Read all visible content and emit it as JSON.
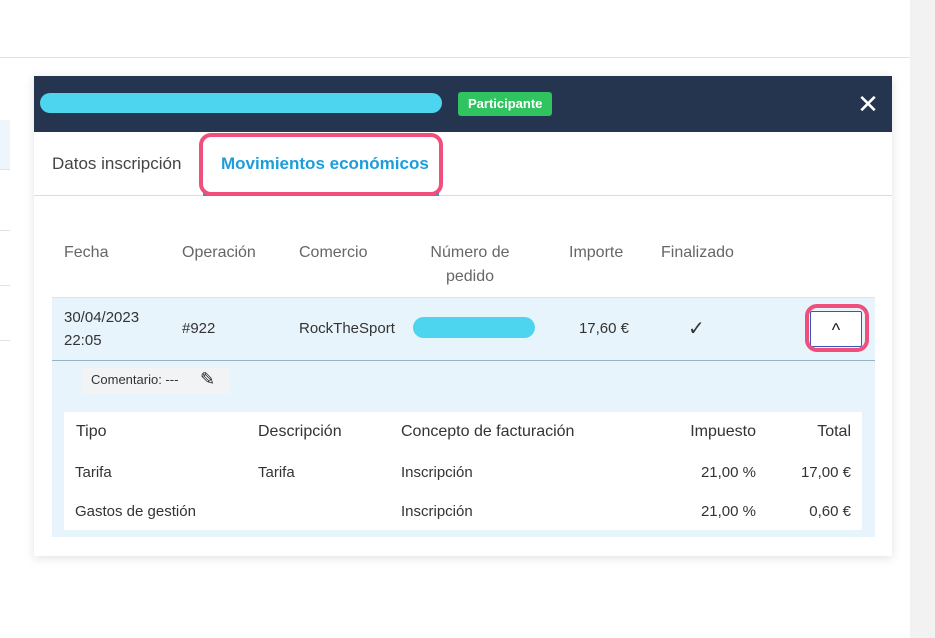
{
  "header": {
    "badge": "Participante",
    "close_glyph": "✕"
  },
  "tabs": [
    {
      "label": "Datos inscripción"
    },
    {
      "label": "Movimientos económicos"
    }
  ],
  "table": {
    "headers": [
      "Fecha",
      "Operación",
      "Comercio",
      "Número de pedido",
      "Importe",
      "Finalizado"
    ],
    "row": {
      "date": "30/04/2023",
      "time": "22:05",
      "operation": "#922",
      "merchant": "RockTheSport",
      "amount": "17,60 €",
      "finished_glyph": "✓",
      "expand_glyph": "^"
    }
  },
  "detail": {
    "comment": "Comentario: ---",
    "headers": [
      "Tipo",
      "Descripción",
      "Concepto de facturación",
      "Impuesto",
      "Total"
    ],
    "rows": [
      {
        "tipo": "Tarifa",
        "descripcion": "Tarifa",
        "concepto": "Inscripción",
        "impuesto": "21,00 %",
        "total": "17,00 €"
      },
      {
        "tipo": "Gastos de gestión",
        "descripcion": "",
        "concepto": "Inscripción",
        "impuesto": "21,00 %",
        "total": "0,60 €"
      }
    ]
  },
  "colors": {
    "header_bg": "#253550",
    "badge_bg": "#2fc45f",
    "accent": "#1e9dd8",
    "highlight": "#ef4f7a",
    "redaction": "#4dd4ee"
  }
}
